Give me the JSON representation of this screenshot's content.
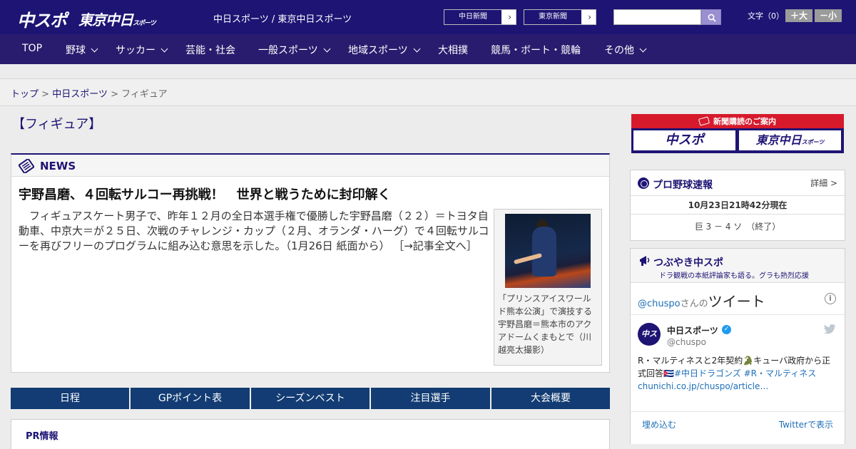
{
  "header": {
    "logo_chuspo": "中スポ",
    "logo_tokyo": "東京中日",
    "logo_tokyo_small": "スポーツ",
    "tagline": "中日スポーツ / 東京中日スポーツ",
    "paper_links": [
      "中日新聞",
      "東京新聞"
    ],
    "search_placeholder": "",
    "font_size_label": "文字（0）",
    "font_plus": "＋大",
    "font_minus": "－小"
  },
  "nav": {
    "items": [
      {
        "label": "TOP",
        "has_caret": false
      },
      {
        "label": "野球",
        "has_caret": true
      },
      {
        "label": "サッカー",
        "has_caret": true
      },
      {
        "label": "芸能・社会",
        "has_caret": false
      },
      {
        "label": "一般スポーツ",
        "has_caret": true
      },
      {
        "label": "地域スポーツ",
        "has_caret": true
      },
      {
        "label": "大相撲",
        "has_caret": false
      },
      {
        "label": "競馬・ボート・競輪",
        "has_caret": false
      },
      {
        "label": "その他",
        "has_caret": true
      }
    ]
  },
  "breadcrumb": {
    "items": [
      "トップ",
      "中日スポーツ",
      "フィギュア"
    ],
    "separator": " > "
  },
  "page_title": "【フィギュア】",
  "news": {
    "label": "NEWS",
    "headline": "宇野昌磨、４回転サルコー再挑戦！　世界と戦うために封印解く",
    "body": "　フィギュアスケート男子で、昨年１２月の全日本選手権で優勝した宇野昌磨（２２）＝トヨタ自動車、中京大＝が２５日、次戦のチャレンジ・カップ（２月、オランダ・ハーグ）で４回転サルコーを再びフリーのプログラムに組み込む意思を示した。（1月26日 紙面から）",
    "read_more": "［→記事全文へ］",
    "photo_caption": "「プリンスアイスワールド熊本公演」で演技する宇野昌磨＝熊本市のアクアドームくまもとで（川越亮太撮影）"
  },
  "tabs": [
    "日程",
    "GPポイント表",
    "シーズンベスト",
    "注目選手",
    "大会概要"
  ],
  "pr": {
    "title": "PR情報"
  },
  "sidebar": {
    "subscription": {
      "title": "新聞購読のご案内",
      "btn_chuspo": "中スポ",
      "btn_tokyo": "東京中日",
      "btn_tokyo_small": "スポーツ"
    },
    "baseball": {
      "title": "プロ野球速報",
      "detail": "詳細 >",
      "time": "10月23日21時42分現在",
      "score": "巨 3 － 4 ソ　（終了）"
    },
    "twitter": {
      "title": "つぶやき中スポ",
      "subtitle": "ドラ観戦の本紙評論家も語る。グラも熱烈応援",
      "handle_link": "@chuspo",
      "san_no": "さんの",
      "tweet_word": "ツイート",
      "account_name": "中日スポーツ",
      "account_handle": "@chuspo",
      "avatar_text": "中スポ",
      "tweet_text": "R・マルティネスと2年契約🐊キューバ政府から正式回答🇨🇺",
      "tweet_tags": "#中日ドラゴンズ #R・マルティネス",
      "tweet_url": "chunichi.co.jp/chuspo/article…",
      "embed_label": "埋め込む",
      "view_label": "Twitterで表示"
    }
  },
  "colors": {
    "brand_navy": "#1e1474",
    "nav_bg": "#291c6e",
    "tab_bg": "#123c73",
    "subscription_red": "#d61a2c",
    "twitter_blue": "#1d9bf0"
  }
}
